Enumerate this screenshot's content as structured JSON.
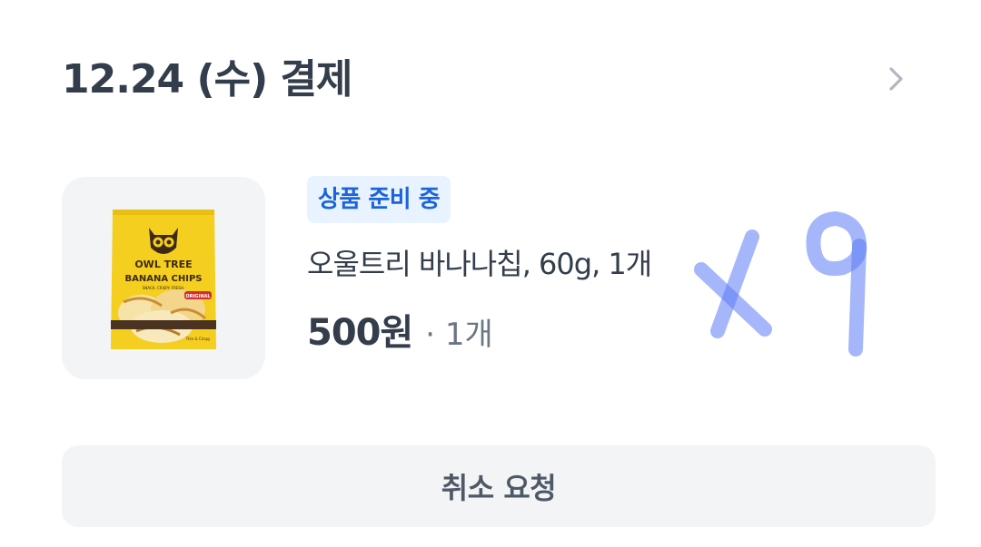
{
  "order": {
    "title": "12.24 (수) 결제",
    "detail_icon": "chevron-right-icon"
  },
  "item": {
    "status": "상품 준비 중",
    "name": "오울트리 바나나칩, 60g, 1개",
    "price": "500원",
    "quantity": "· 1개",
    "image": {
      "brand": "OWL TREE",
      "product": "BANANA CHIPS",
      "tagline": "SNACK. CRISPY. FRESH.",
      "variant": "ORIGINAL",
      "footer": "Thin & Crispy"
    },
    "handwritten_note": "x9"
  },
  "actions": {
    "cancel_label": "취소 요청"
  },
  "colors": {
    "text_primary": "#333d4b",
    "text_secondary": "#6b7684",
    "badge_bg": "#e8f3ff",
    "badge_text": "#1b64da",
    "button_bg": "#f2f4f6",
    "handwriting": "#5b7cf5"
  }
}
